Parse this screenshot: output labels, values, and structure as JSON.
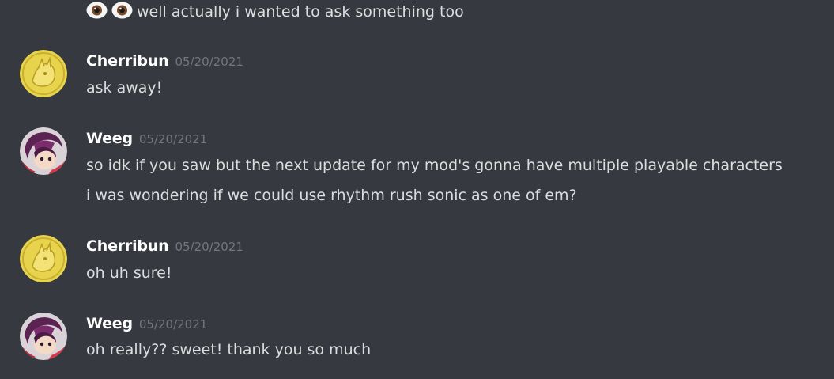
{
  "messages": [
    {
      "continuation": true,
      "lines": [
        "well actually i wanted to ask something too"
      ],
      "emojis": [
        "eyes-emoji",
        "eyes-emoji"
      ]
    },
    {
      "author": "Cherribun",
      "timestamp": "05/20/2021",
      "avatar": "cherribun-avatar",
      "lines": [
        "ask away!"
      ]
    },
    {
      "author": "Weeg",
      "timestamp": "05/20/2021",
      "avatar": "weeg-avatar",
      "lines": [
        "so idk if you saw but the next update for my mod's gonna have multiple playable characters",
        "i was wondering if we could use rhythm rush sonic as one of em?"
      ]
    },
    {
      "author": "Cherribun",
      "timestamp": "05/20/2021",
      "avatar": "cherribun-avatar",
      "lines": [
        "oh uh sure!"
      ]
    },
    {
      "author": "Weeg",
      "timestamp": "05/20/2021",
      "avatar": "weeg-avatar",
      "lines": [
        "oh really?? sweet! thank you so much"
      ]
    }
  ],
  "colors": {
    "background": "#36393f",
    "message_text": "#dcddde",
    "username": "#ffffff",
    "timestamp": "#72767d",
    "cherribun_avatar": "#ead54a",
    "weeg_avatar": "#6b2a5a"
  }
}
